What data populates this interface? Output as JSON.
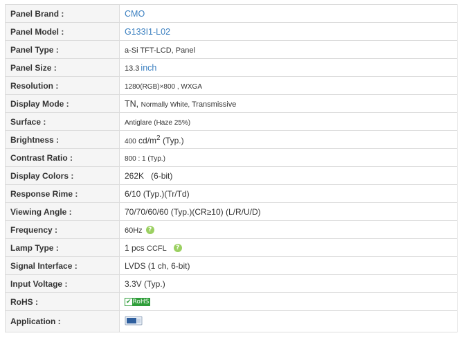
{
  "rows": [
    {
      "label": "Panel Brand :",
      "value": "CMO"
    },
    {
      "label": "Panel Model :",
      "value": "G133I1-L02"
    },
    {
      "label": "Panel Type :",
      "value": "a-Si TFT-LCD, Panel"
    },
    {
      "label": "Panel Size :",
      "value_num": "13.3",
      "value_unit": "inch"
    },
    {
      "label": "Resolution :",
      "value": "1280(RGB)×800 , WXGA"
    },
    {
      "label": "Display Mode :",
      "value_a": "TN, ",
      "value_b": "Normally White, ",
      "value_c": "Transmissive"
    },
    {
      "label": "Surface :",
      "value": "Antiglare (Haze 25%)"
    },
    {
      "label": "Brightness :",
      "value_num": "400",
      "value_unit": "cd/m",
      "value_sup": "2",
      "value_note": "(Typ.)"
    },
    {
      "label": "Contrast Ratio :",
      "value": "800 : 1 (Typ.)"
    },
    {
      "label": "Display Colors :",
      "value": "262K   (6-bit)"
    },
    {
      "label": "Response Rime :",
      "value": "6/10 (Typ.)(Tr/Td)"
    },
    {
      "label": "Viewing Angle :",
      "value": "70/70/60/60 (Typ.)(CR≥10) (L/R/U/D)"
    },
    {
      "label": "Frequency :",
      "value": "60Hz",
      "help_icon": "help-icon"
    },
    {
      "label": "Lamp Type :",
      "value_a": "1 pcs",
      "value_b": "CCFL",
      "help_icon": "help-icon"
    },
    {
      "label": "Signal Interface :",
      "value": "LVDS (1 ch, 6-bit)"
    },
    {
      "label": "Input Voltage :",
      "value": "3.3V (Typ.)"
    },
    {
      "label": "RoHS :",
      "badge": "RoHS",
      "badge_icon": "check-icon"
    },
    {
      "label": "Application :",
      "icon": "laptop-monitor-icon"
    }
  ],
  "colors": {
    "link": "#3a7fc0",
    "label_bg": "#f5f5f5",
    "border": "#dcdcdc",
    "help": "#9bd061",
    "rohs": "#2f9e3a"
  }
}
